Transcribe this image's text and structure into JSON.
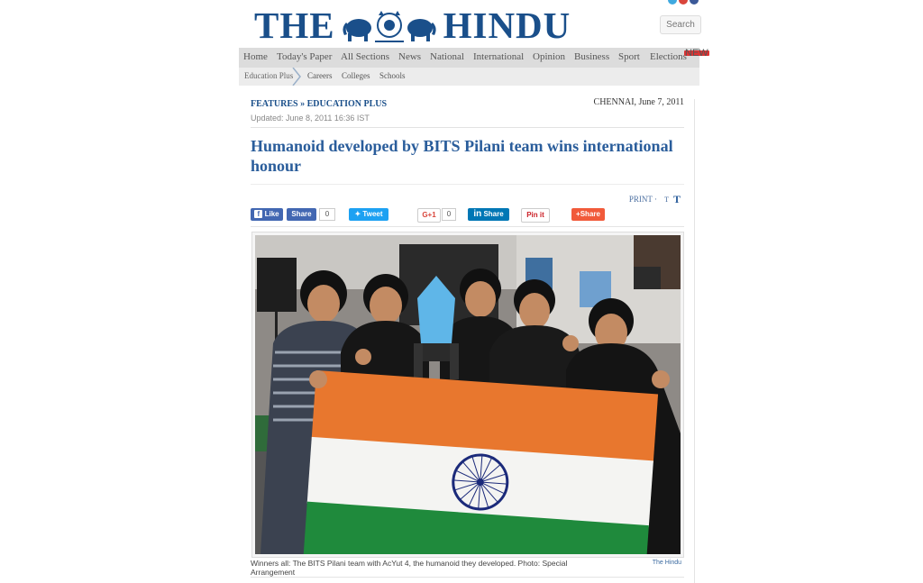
{
  "masthead": {
    "logo_left": "THE",
    "logo_right": "HINDU",
    "search_label": "Search"
  },
  "nav": {
    "items": [
      "Home",
      "Today's Paper",
      "All Sections",
      "News",
      "National",
      "International",
      "Opinion",
      "Business",
      "Sport",
      "Elections"
    ],
    "elections_badge": "NEW"
  },
  "subnav": {
    "items": [
      "Education Plus",
      "Careers",
      "Colleges",
      "Schools"
    ]
  },
  "article": {
    "section": "FEATURES",
    "separator": "»",
    "subsection": "EDUCATION PLUS",
    "dateline": "CHENNAI, June 7, 2011",
    "updated": "Updated: June 8, 2011 16:36 IST",
    "headline": "Humanoid developed by BITS Pilani team wins international honour",
    "print_label": "PRINT",
    "font_dash": "·",
    "font_small": "T",
    "font_big": "T"
  },
  "share": {
    "fb_like": "Like",
    "fb_share": "Share",
    "fb_count": "0",
    "tweet": "Tweet",
    "gplus": "G+1",
    "gplus_count": "0",
    "linkedin": "Share",
    "pinterest": "Pin it",
    "share_plus": "Share"
  },
  "photo": {
    "caption": "Winners all: The BITS Pilani team with AcYut 4, the humanoid they developed. Photo: Special Arrangement",
    "credit": "The Hindu"
  },
  "colors": {
    "brand": "#1a4f8a",
    "headline": "#2a5d9b",
    "saffron": "#e8772e",
    "green": "#1f8a3c",
    "chakra": "#1b2a7a"
  }
}
